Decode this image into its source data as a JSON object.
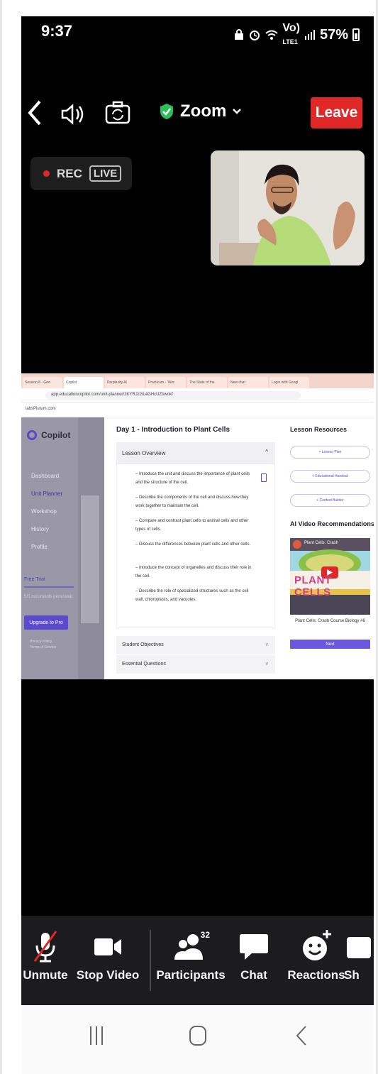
{
  "status_bar": {
    "time": "9:37",
    "network": "Vo)",
    "network_sub": "LTE1",
    "battery": "57%"
  },
  "meeting_bar": {
    "app_title": "Zoom",
    "leave_label": "Leave",
    "rec_label": "REC",
    "live_label": "LIVE"
  },
  "shared_screen": {
    "tabs": [
      "Session 8 - Goo",
      "Copilot",
      "Perplexity AI",
      "Practicum - ‘Wor",
      "The State of the",
      "New chat",
      "Login with Googl"
    ],
    "url": "app.educationcopilot.com/unit-planner/2KYRJzGL4GHcUZhwokf",
    "bookmark": "labsPlutum.com",
    "sidebar": {
      "logo": "Copilot",
      "nav": [
        "Dashboard",
        "Unit Planner",
        "Workshop",
        "History",
        "Profile"
      ],
      "free_trial": "Free Trial",
      "trial_text": "5/5 documents generated",
      "upgrade": "Upgrade to Pro",
      "footer": [
        "Privacy Policy",
        "Terms of Service"
      ]
    },
    "lesson": {
      "title": "Day 1 - Introduction to Plant Cells",
      "overview_label": "Lesson Overview",
      "bullets": [
        "– Introduce the unit and discuss the importance of plant cells and the structure of the cell.",
        "– Describe the components of the cell and discuss how they work together to maintain the cell.",
        "– Compare and contrast plant cells to animal cells and other types of cells.",
        "– Discuss the differences between plant cells and other cells.",
        "– Introduce the concept of organelles and discuss their role in the cell.",
        "– Describe the role of specialized structures such as the cell wall, chloroplasts, and vacuoles."
      ],
      "student_objectives": "Student Objectives",
      "essential_questions": "Essential Questions"
    },
    "resources": {
      "title": "Lesson Resources",
      "buttons": [
        "+ Lesson Plan",
        "+ Educational Handout",
        "+ Context Builder"
      ],
      "ai_title": "AI Video Recommendations",
      "thumb_text": "PLANT CELLS",
      "thumb_top": "Plant Cells: Crash",
      "video_caption": "Plant Cells: Crash Course Biology #6",
      "next": "Next"
    }
  },
  "toolbar": {
    "unmute": "Unmute",
    "stop_video": "Stop Video",
    "participants": "Participants",
    "participants_count": "32",
    "chat": "Chat",
    "reactions": "Reactions",
    "share": "Sh"
  },
  "colors": {
    "leave_red": "#e02828",
    "zoom_green": "#2fbf5a",
    "copilot_purple": "#5a4ad0"
  }
}
